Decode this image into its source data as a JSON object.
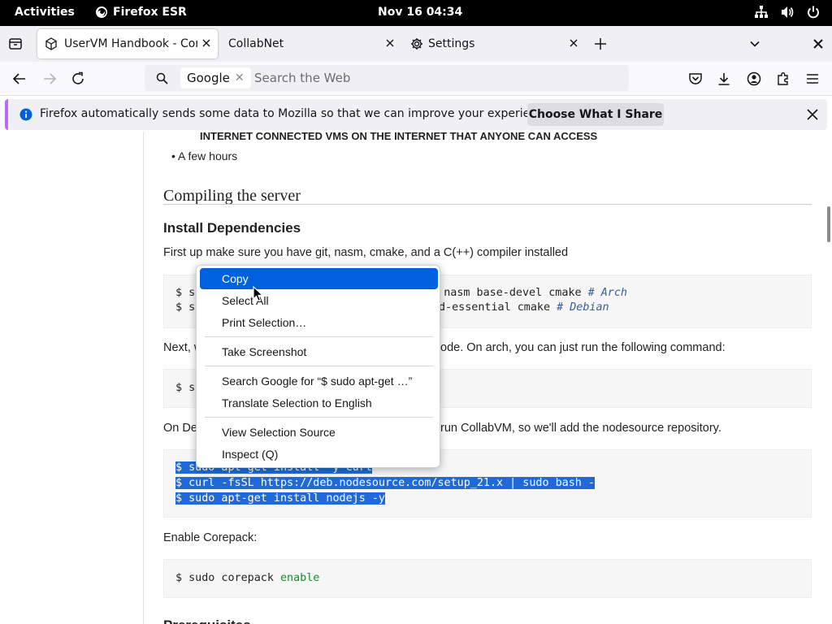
{
  "topbar": {
    "activities": "Activities",
    "app_name": "Firefox ESR",
    "clock": "Nov 16  04:34"
  },
  "tabs": [
    {
      "title": "UserVM Handbook - Com",
      "active": true
    },
    {
      "title": "CollabNet",
      "active": false
    },
    {
      "title": "Settings",
      "active": false
    }
  ],
  "urlbar": {
    "engine": "Google",
    "placeholder": "Search the Web"
  },
  "notification": {
    "message": "Firefox automatically sends some data to Mozilla so that we can improve your experience.",
    "button": "Choose What I Share",
    "accent": "#b26ff5"
  },
  "page": {
    "caps_line": "INTERNET CONNECTED VMS ON THE INTERNET THAT ANYONE CAN ACCESS",
    "bullet": "A few hours",
    "h2": "Compiling the server",
    "h3": "Install Dependencies",
    "p1": "First up make sure you have git, nasm, cmake, and a C(++) compiler installed",
    "code1": {
      "line1_prefix": "$ s",
      "line1_visible": "git nasm base-devel cmake ",
      "line1_comment": "# Arch",
      "line2_prefix": "$ s",
      "line2_visible": "d-essential cmake ",
      "line2_comment": "# Debian"
    },
    "p2_left": "Next, w",
    "p2_right": "ode. On arch, you can just run the following command:",
    "code2_prefix": "$ s",
    "p3_left": "On De",
    "p3_right": "run CollabVM, so we'll add the nodesource repository.",
    "code3": [
      "$ sudo apt-get install -y curl",
      "$ curl -fsSL https://deb.nodesource.com/setup_21.x | sudo bash -",
      "$ sudo apt-get install nodejs -y"
    ],
    "p4": "Enable Corepack:",
    "code4": {
      "cmd": "$ sudo corepack ",
      "arg": "enable"
    },
    "partial_heading": "Prerequisites"
  },
  "context_menu": {
    "items": [
      {
        "label": "Copy",
        "highlighted": true
      },
      {
        "label": "Select All"
      },
      {
        "label": "Print Selection…"
      },
      {
        "label": "Take Screenshot"
      },
      {
        "label": "Search Google for “$ sudo apt-get …”"
      },
      {
        "label": "Translate Selection to English"
      },
      {
        "label": "View Selection Source"
      },
      {
        "label": "Inspect (Q)"
      }
    ]
  },
  "colors": {
    "selection": "#1f6ad8",
    "menu_highlight": "#0061e0"
  }
}
